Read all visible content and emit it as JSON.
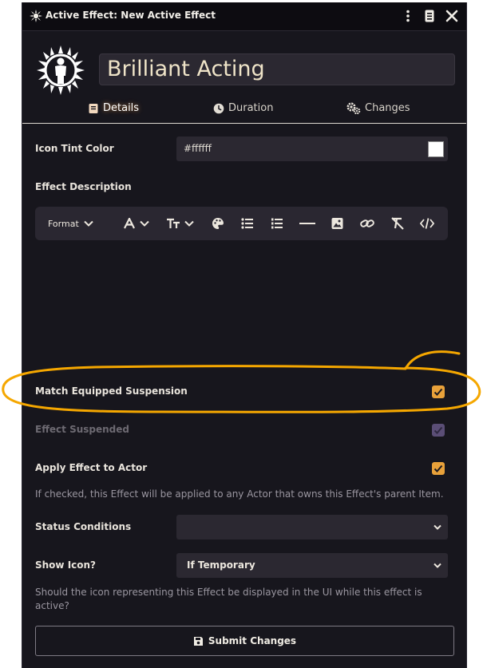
{
  "window": {
    "title": "Active Effect: New Active Effect",
    "buttons": [
      {
        "name": "menu",
        "icon": "vertical-ellipsis-icon"
      },
      {
        "name": "sheet",
        "icon": "sheet-config-icon"
      },
      {
        "name": "close",
        "icon": "close-icon"
      }
    ]
  },
  "header": {
    "effect_name": "Brilliant Acting",
    "icon": "radiant-figure-icon"
  },
  "tabs": [
    {
      "label": "Details",
      "icon": "book-icon",
      "active": true
    },
    {
      "label": "Duration",
      "icon": "clock-icon",
      "active": false
    },
    {
      "label": "Changes",
      "icon": "cogs-icon",
      "active": false
    }
  ],
  "details": {
    "icon_tint": {
      "label": "Icon Tint Color",
      "value": "#ffffff"
    },
    "description": {
      "label": "Effect Description",
      "toolbar": {
        "format_label": "Format",
        "tools": [
          "font-icon",
          "text-size-icon",
          "palette-icon",
          "bullet-list-icon",
          "numbered-list-icon",
          "horizontal-rule-icon",
          "image-icon",
          "link-icon",
          "clear-format-icon",
          "source-code-icon"
        ]
      }
    },
    "match_equipped": {
      "label": "Match Equipped Suspension",
      "checked": true
    },
    "suspended": {
      "label": "Effect Suspended",
      "checked": true,
      "disabled": true
    },
    "apply_to_actor": {
      "label": "Apply Effect to Actor",
      "checked": true,
      "hint": "If checked, this Effect will be applied to any Actor that owns this Effect's parent Item."
    },
    "status_conditions": {
      "label": "Status Conditions",
      "value": ""
    },
    "show_icon": {
      "label": "Show Icon?",
      "value": "If Temporary",
      "hint": "Should the icon representing this Effect be displayed in the UI while this effect is active?"
    }
  },
  "submit": {
    "label": "Submit Changes"
  },
  "colors": {
    "background": "#17161d",
    "accent": "#e8a13a",
    "highlight": "#f5a700",
    "disabled_checkbox": "#5b4e76"
  }
}
